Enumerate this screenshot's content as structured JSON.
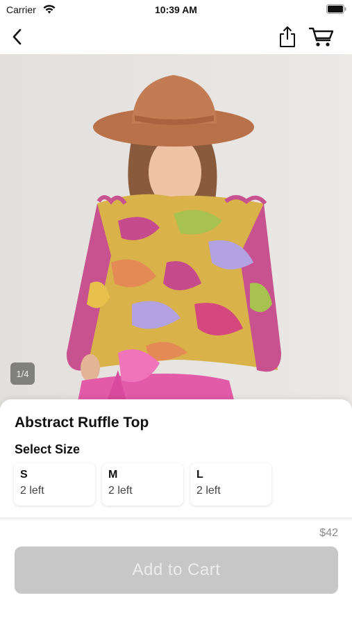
{
  "status_bar": {
    "carrier": "Carrier",
    "time": "10:39 AM",
    "icons": [
      "wifi-icon",
      "battery-icon"
    ]
  },
  "nav_bar": {
    "icons": [
      "back-chevron-icon",
      "share-icon",
      "cart-icon"
    ]
  },
  "product": {
    "image_counter": "1/4",
    "title": "Abstract Ruffle Top",
    "size_heading": "Select Size",
    "sizes": [
      {
        "label": "S",
        "stock": "2 left"
      },
      {
        "label": "M",
        "stock": "2 left"
      },
      {
        "label": "L",
        "stock": "2 left"
      }
    ],
    "price": "$42",
    "add_to_cart_label": "Add to Cart"
  },
  "colors": {
    "button_disabled": "#c7c7c7",
    "price_text": "#8a8a8a"
  }
}
